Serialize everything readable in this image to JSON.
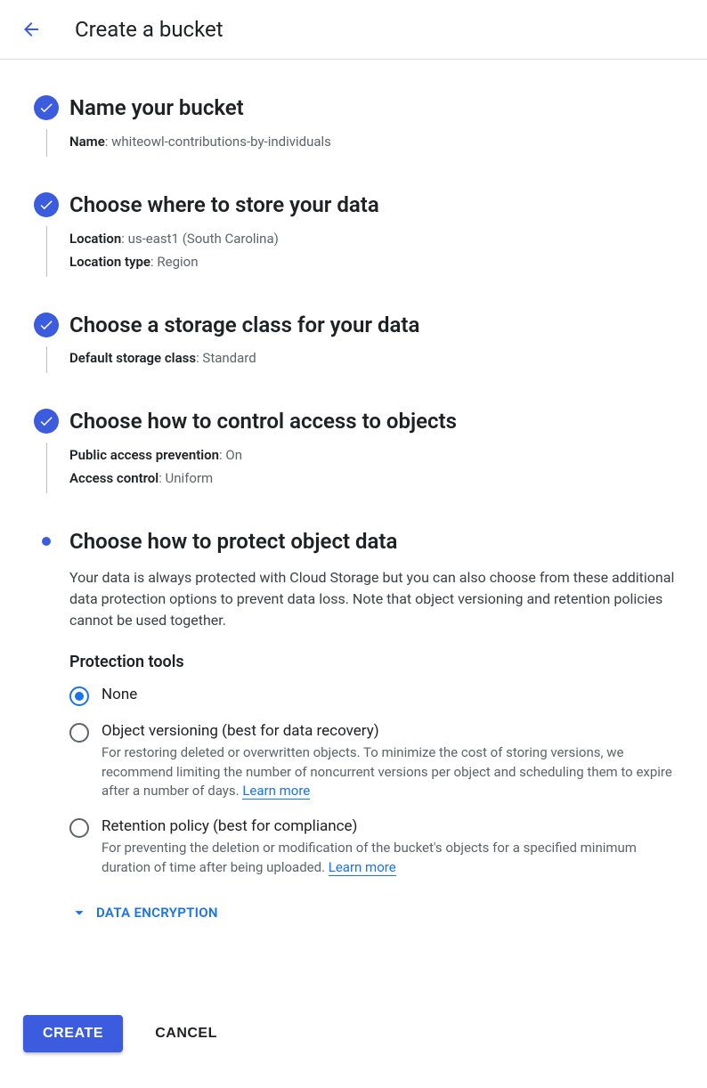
{
  "header": {
    "title": "Create a bucket"
  },
  "steps": {
    "name": {
      "title": "Name your bucket",
      "name_label": "Name",
      "name_value": "whiteowl-contributions-by-individuals"
    },
    "location": {
      "title": "Choose where to store your data",
      "loc_label": "Location",
      "loc_value": "us-east1 (South Carolina)",
      "loctype_label": "Location type",
      "loctype_value": "Region"
    },
    "storage": {
      "title": "Choose a storage class for your data",
      "class_label": "Default storage class",
      "class_value": "Standard"
    },
    "access": {
      "title": "Choose how to control access to objects",
      "pap_label": "Public access prevention",
      "pap_value": "On",
      "ac_label": "Access control",
      "ac_value": "Uniform"
    },
    "protect": {
      "title": "Choose how to protect object data",
      "desc": "Your data is always protected with Cloud Storage but you can also choose from these additional data protection options to prevent data loss. Note that object versioning and retention policies cannot be used together.",
      "tools_heading": "Protection tools",
      "options": {
        "none": {
          "label": "None"
        },
        "versioning": {
          "label": "Object versioning (best for data recovery)",
          "help": "For restoring deleted or overwritten objects. To minimize the cost of storing versions, we recommend limiting the number of noncurrent versions per object and scheduling them to expire after a number of days. ",
          "learn": "Learn more"
        },
        "retention": {
          "label": "Retention policy (best for compliance)",
          "help": "For preventing the deletion or modification of the bucket's objects for a specified minimum duration of time after being uploaded. ",
          "learn": "Learn more"
        }
      },
      "encryption_toggle": "DATA ENCRYPTION"
    }
  },
  "actions": {
    "create": "CREATE",
    "cancel": "CANCEL"
  }
}
